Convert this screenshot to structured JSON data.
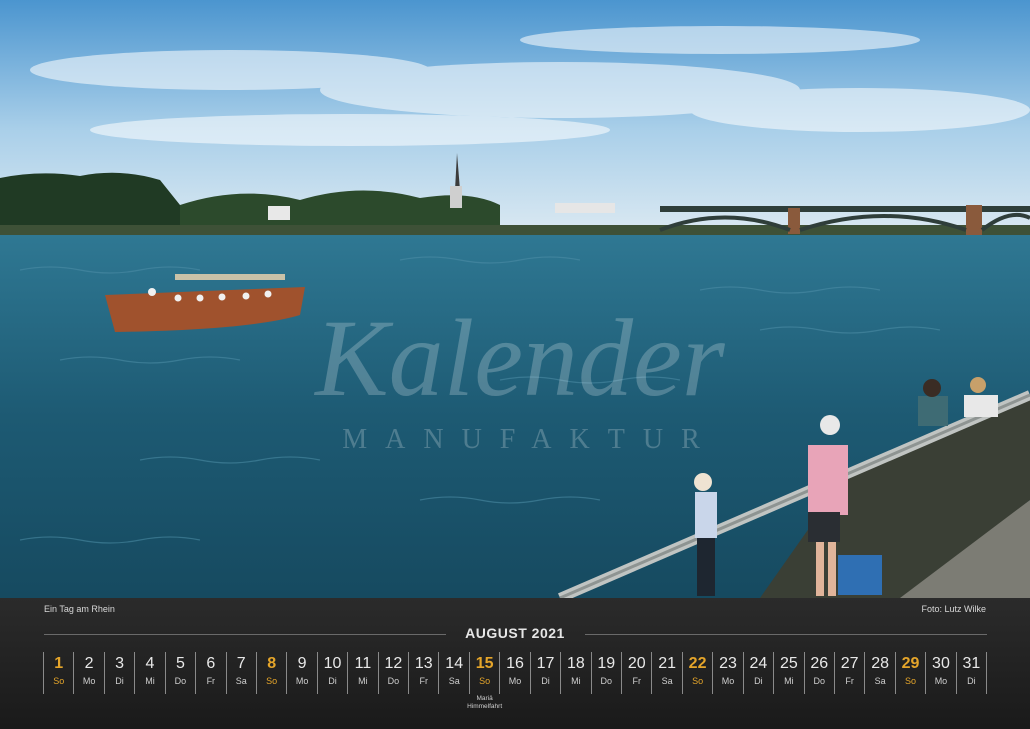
{
  "watermark": {
    "line1": "Kalender",
    "line2": "MANUFAKTUR"
  },
  "calendar": {
    "caption_left": "Ein Tag am Rhein",
    "caption_right": "Foto: Lutz Wilke",
    "month": "AUGUST 2021",
    "days": [
      {
        "n": "1",
        "wd": "So",
        "type": "sun"
      },
      {
        "n": "2",
        "wd": "Mo"
      },
      {
        "n": "3",
        "wd": "Di"
      },
      {
        "n": "4",
        "wd": "Mi"
      },
      {
        "n": "5",
        "wd": "Do"
      },
      {
        "n": "6",
        "wd": "Fr"
      },
      {
        "n": "7",
        "wd": "Sa"
      },
      {
        "n": "8",
        "wd": "So",
        "type": "sun"
      },
      {
        "n": "9",
        "wd": "Mo"
      },
      {
        "n": "10",
        "wd": "Di"
      },
      {
        "n": "11",
        "wd": "Mi"
      },
      {
        "n": "12",
        "wd": "Do"
      },
      {
        "n": "13",
        "wd": "Fr"
      },
      {
        "n": "14",
        "wd": "Sa"
      },
      {
        "n": "15",
        "wd": "So",
        "type": "hol",
        "note": "Mariä\nHimmelfahrt"
      },
      {
        "n": "16",
        "wd": "Mo"
      },
      {
        "n": "17",
        "wd": "Di"
      },
      {
        "n": "18",
        "wd": "Mi"
      },
      {
        "n": "19",
        "wd": "Do"
      },
      {
        "n": "20",
        "wd": "Fr"
      },
      {
        "n": "21",
        "wd": "Sa"
      },
      {
        "n": "22",
        "wd": "So",
        "type": "sun"
      },
      {
        "n": "23",
        "wd": "Mo"
      },
      {
        "n": "24",
        "wd": "Di"
      },
      {
        "n": "25",
        "wd": "Mi"
      },
      {
        "n": "26",
        "wd": "Do"
      },
      {
        "n": "27",
        "wd": "Fr"
      },
      {
        "n": "28",
        "wd": "Sa"
      },
      {
        "n": "29",
        "wd": "So",
        "type": "sun"
      },
      {
        "n": "30",
        "wd": "Mo"
      },
      {
        "n": "31",
        "wd": "Di"
      }
    ]
  },
  "colors": {
    "accent": "#e5a52a",
    "water": "#1d5a73",
    "sky": "#7fb6dd"
  }
}
